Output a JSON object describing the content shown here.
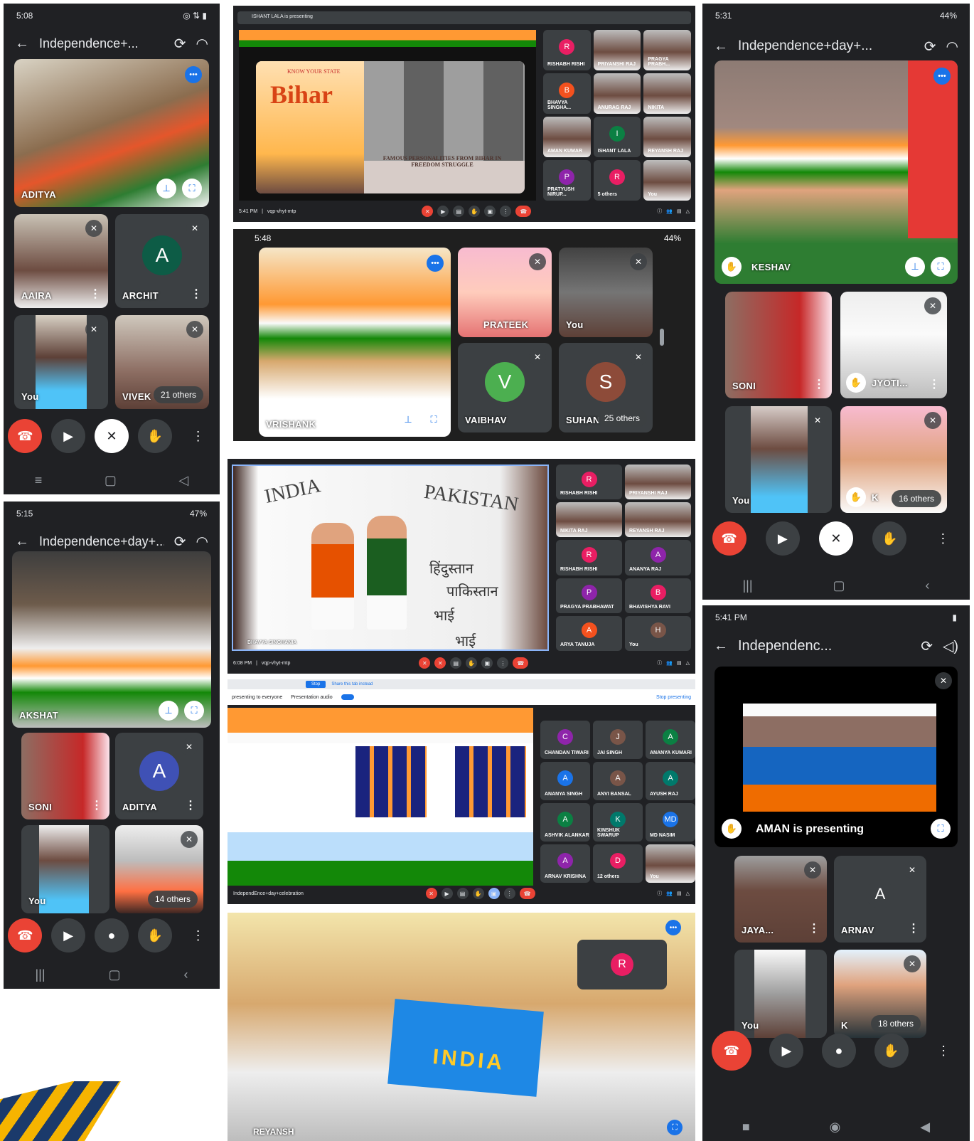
{
  "p1": {
    "time": "5:08",
    "title": "Independence+...",
    "main": "ADITYA",
    "t1": "AAIRA",
    "t2": "ARCHIT",
    "t2i": "A",
    "t3": "You",
    "t4": "VIVEK",
    "others": "21 others"
  },
  "p2": {
    "time": "5:15",
    "battery": "47%",
    "title": "Independence+day+...",
    "main": "AKSHAT",
    "t1": "SONI",
    "t2": "ADITYA",
    "t2i": "A",
    "t3": "You",
    "others": "14 others"
  },
  "p3": {
    "time": "5:31",
    "battery": "44%",
    "title": "Independence+day+...",
    "main": "KESHAV",
    "t1": "SONI",
    "t2": "JYOTI...",
    "t3": "You",
    "t4": "K",
    "others": "16 others"
  },
  "p4": {
    "time": "5:41 PM",
    "title": "Independenc...",
    "presenting": "AMAN is presenting",
    "t1": "JAYA...",
    "t2": "ARNAV",
    "t2i": "A",
    "t3": "You",
    "t4": "K",
    "others": "18 others"
  },
  "m1": {
    "banner": "ISHANT LALA is presenting",
    "slide_title": "Bihar",
    "slide_tag": "KNOW YOUR STATE",
    "slide_caption": "FAMOUS PERSONALITIES FROM BIHAR IN FREEDOM STRUGGLE",
    "time": "5:41 PM",
    "code": "vqp-vhyt-mtp",
    "grid": [
      {
        "n": "RISHABH RISHI",
        "i": "R",
        "c": "#e91e63"
      },
      {
        "n": "PRIYANSHI RAJ",
        "i": "",
        "c": ""
      },
      {
        "n": "PRAGYA PRABH...",
        "i": "",
        "c": ""
      },
      {
        "n": "BHAVYA SINGHA...",
        "i": "B",
        "c": "#f4511e"
      },
      {
        "n": "ANURAG RAJ",
        "i": "",
        "c": ""
      },
      {
        "n": "NIKITA",
        "i": "",
        "c": ""
      },
      {
        "n": "AMAN KUMAR",
        "i": "",
        "c": ""
      },
      {
        "n": "ISHANT LALA",
        "i": "I",
        "c": "#0b8043"
      },
      {
        "n": "REYANSH RAJ",
        "i": "",
        "c": ""
      },
      {
        "n": "PRATYUSH NIRUP...",
        "i": "P",
        "c": "#8e24aa"
      },
      {
        "n": "5 others",
        "i": "R",
        "c": "#e91e63"
      },
      {
        "n": "You",
        "i": "",
        "c": ""
      }
    ]
  },
  "m2": {
    "time": "5:48",
    "battery": "44%",
    "main": "VRISHANK",
    "t1": "PRATEEK",
    "t2": "You",
    "t3": "VAIBHAV",
    "t3i": "V",
    "t4": "SUHAN",
    "t4i": "S",
    "others": "25 others"
  },
  "m3": {
    "left_text": "INDIA",
    "right_text": "PAKISTAN",
    "hindi1": "हिंदुस्तान",
    "hindi2": "पाकिस्तान",
    "hindi3": "भाई",
    "hindi4": "भाई",
    "presenter": "BHAVYA SINGHANIA",
    "time": "6:08 PM",
    "code": "vqp-vhyt-mtp",
    "grid": [
      {
        "n": "RISHABH RISHI",
        "i": "R",
        "c": "#e91e63"
      },
      {
        "n": "PRIYANSHI RAJ",
        "i": "",
        "c": ""
      },
      {
        "n": "NIKITA RAJ",
        "i": "",
        "c": ""
      },
      {
        "n": "REYANSH RAJ",
        "i": "",
        "c": ""
      },
      {
        "n": "RISHABH RISHI",
        "i": "R",
        "c": "#e91e63"
      },
      {
        "n": "ANANYA RAJ",
        "i": "A",
        "c": "#8e24aa"
      },
      {
        "n": "PRAGYA PRABHAWAT",
        "i": "P",
        "c": "#8e24aa"
      },
      {
        "n": "BHAVISHYA RAVI",
        "i": "B",
        "c": "#e91e63"
      },
      {
        "n": "ARYA TANUJA",
        "i": "A",
        "c": "#f4511e"
      },
      {
        "n": "You",
        "i": "H",
        "c": "#795548"
      }
    ]
  },
  "m4": {
    "stop": "Stop",
    "share": "Share this tab instead",
    "presenting": "presenting to everyone",
    "audio": "Presentation audio",
    "stop_presenting": "Stop presenting",
    "meeting": "IndependEnce+day+celebration",
    "grid": [
      {
        "n": "CHANDAN TIWARI",
        "i": "C",
        "c": "#8e24aa"
      },
      {
        "n": "JAI SINGH",
        "i": "J",
        "c": "#795548"
      },
      {
        "n": "ANANYA KUMARI",
        "i": "A",
        "c": "#0b8043"
      },
      {
        "n": "ANANYA SINGH",
        "i": "A",
        "c": "#1a73e8"
      },
      {
        "n": "ANVI BANSAL",
        "i": "A",
        "c": "#795548"
      },
      {
        "n": "AYUSH RAJ",
        "i": "A",
        "c": "#00796b"
      },
      {
        "n": "ASHVIK ALANKAR",
        "i": "A",
        "c": "#0b8043"
      },
      {
        "n": "KINSHUK SWARUP",
        "i": "K",
        "c": "#00796b"
      },
      {
        "n": "MD NASIM",
        "i": "MD",
        "c": "#1a73e8"
      },
      {
        "n": "ARNAV KRISHNA",
        "i": "A",
        "c": "#8e24aa"
      },
      {
        "n": "12 others",
        "i": "D",
        "c": "#e91e63"
      },
      {
        "n": "You",
        "i": "",
        "c": ""
      }
    ]
  },
  "m5": {
    "main": "REYANSH",
    "r": "R",
    "art": "INDIA"
  }
}
